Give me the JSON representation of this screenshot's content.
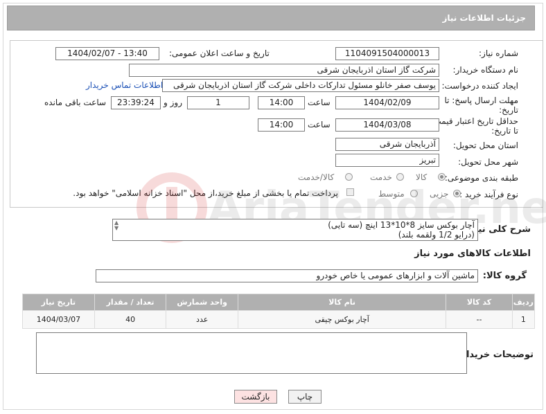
{
  "header": {
    "title": "جزئیات اطلاعات نیاز"
  },
  "form": {
    "need_number_label": "شماره نیاز:",
    "need_number": "1104091504000013",
    "announce_label": "تاریخ و ساعت اعلان عمومی:",
    "announce_value": "1404/02/07 - 13:40",
    "buyer_org_label": "نام دستگاه خریدار:",
    "buyer_org": "شرکت گاز استان اذربایجان شرقی",
    "creator_label": "ایجاد کننده درخواست:",
    "creator": "یوسف صفر خانلو  مسئول تدارکات داخلی  شرکت گاز استان اذربایجان شرقی",
    "contact_link": "اطلاعات تماس خریدار",
    "deadline_label_1": "مهلت ارسال پاسخ: تا",
    "deadline_label_2": "تاریخ:",
    "deadline_date": "1404/02/09",
    "time_label": "ساعت",
    "deadline_time": "14:00",
    "days_value": "1",
    "days_label": "روز و",
    "remaining_time": "23:39:24",
    "remaining_label": "ساعت باقی مانده",
    "price_validity_label_1": "حداقل تاریخ اعتبار قیمت:",
    "price_validity_label_2": "تا تاریخ:",
    "price_validity_date": "1404/03/08",
    "price_validity_time": "14:00",
    "delivery_province_label": "استان محل تحویل:",
    "delivery_province": "آذربایجان شرقی",
    "delivery_city_label": "شهر محل تحویل:",
    "delivery_city": "تبریز",
    "category_label": "طبقه بندی موضوعی:",
    "category_options": [
      "کالا",
      "خدمت",
      "کالا/خدمت"
    ],
    "purchase_type_label": "نوع فرآیند خرید :",
    "purchase_type_options": [
      "جزیی",
      "متوسط"
    ],
    "payment_note": "پرداخت تمام یا بخشی از مبلغ خرید،از محل \"اسناد خزانه اسلامی\" خواهد بود."
  },
  "description": {
    "label": "شرح کلی نیاز:",
    "line1": "آچار بوکس سایز 8*10*13 اینچ (سه تایی)",
    "line2": "(درایو 1/2 ولقمه بلند)"
  },
  "goods_section": {
    "title": "اطلاعات کالاهای مورد نیاز",
    "group_label": "گروه کالا:",
    "group_value": "ماشین آلات و ابزارهای عمومی یا خاص خودرو"
  },
  "table": {
    "headers": [
      "ردیف",
      "کد کالا",
      "نام کالا",
      "واحد شمارش",
      "تعداد / مقدار",
      "تاریخ نیاز"
    ],
    "rows": [
      [
        "1",
        "--",
        "آچار بوکس چپقی",
        "عدد",
        "40",
        "1404/03/07"
      ]
    ]
  },
  "notes": {
    "label": "توضیحات خریدار:"
  },
  "buttons": {
    "print": "چاپ",
    "back": "بازگشت"
  },
  "colors": {
    "header_bg": "#b0b0b0",
    "link": "#1a4fb5",
    "back_button_bg": "#fde2e2"
  }
}
